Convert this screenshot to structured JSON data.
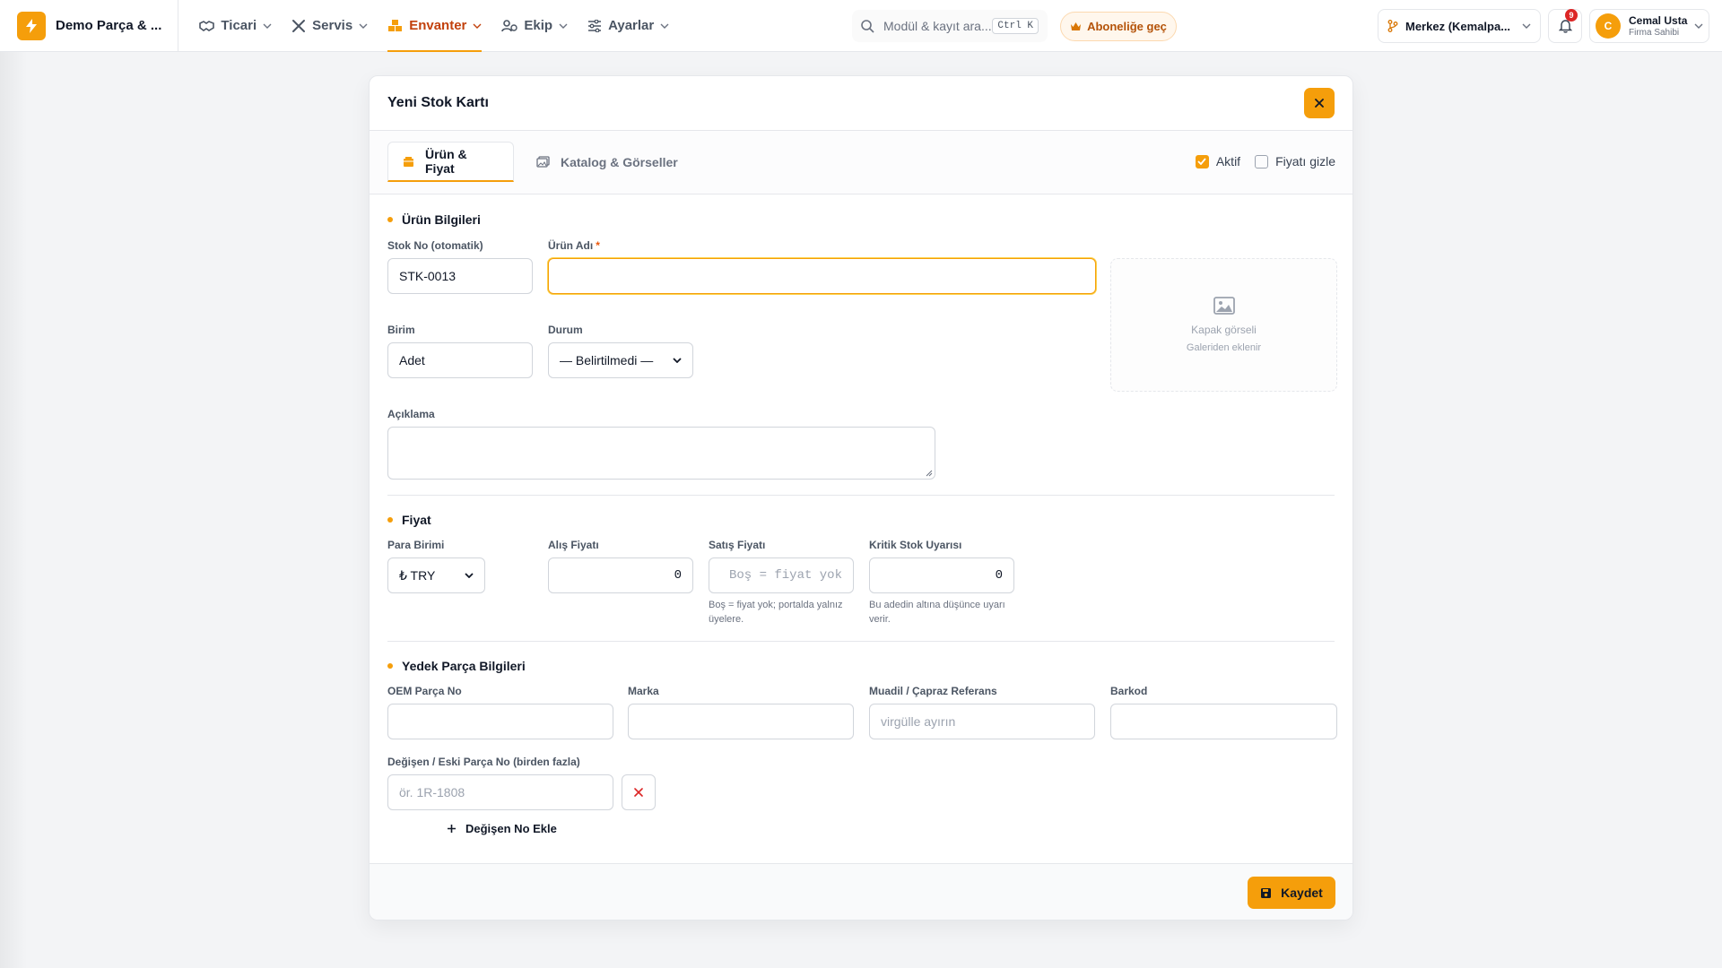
{
  "brand": {
    "name": "Demo Parça & ..."
  },
  "nav": {
    "items": [
      {
        "label": "Ticari",
        "icon": "handshake-icon"
      },
      {
        "label": "Servis",
        "icon": "tools-icon"
      },
      {
        "label": "Envanter",
        "icon": "boxes-icon",
        "active": true
      },
      {
        "label": "Ekip",
        "icon": "users-icon"
      },
      {
        "label": "Ayarlar",
        "icon": "sliders-icon"
      }
    ]
  },
  "search": {
    "placeholder": "Modül & kayıt ara...",
    "shortcut": "Ctrl K"
  },
  "subscribe": {
    "label": "Aboneliğe geç"
  },
  "branch": {
    "label": "Merkez (Kemalpa..."
  },
  "notifications": {
    "count": "9"
  },
  "user": {
    "initial": "C",
    "name": "Cemal Usta",
    "role": "Firma Sahibi"
  },
  "colors": {
    "accent": "#f59e0b",
    "accent_text": "#c2410c",
    "danger": "#dc2626"
  },
  "modal": {
    "title": "Yeni Stok Kartı",
    "tabs": [
      {
        "label": "Ürün & Fiyat",
        "icon": "box-icon"
      },
      {
        "label": "Katalog & Görseller",
        "icon": "images-icon"
      }
    ],
    "toggles": {
      "active_label": "Aktif",
      "active_checked": true,
      "hide_price_label": "Fiyatı gizle",
      "hide_price_checked": false
    },
    "product": {
      "section_title": "Ürün Bilgileri",
      "stock_no_label": "Stok No (otomatik)",
      "stock_no_value": "STK-0013",
      "name_label": "Ürün Adı",
      "required_mark": "*",
      "name_value": "",
      "unit_label": "Birim",
      "unit_value": "Adet",
      "status_label": "Durum",
      "status_value": "— Belirtilmedi —",
      "description_label": "Açıklama",
      "cover_title": "Kapak görseli",
      "cover_subtitle": "Galeriden eklenir"
    },
    "price": {
      "section_title": "Fiyat",
      "currency_label": "Para Birimi",
      "currency_value": "₺ TRY",
      "purchase_label": "Alış Fiyatı",
      "purchase_value": "0",
      "sale_label": "Satış Fiyatı",
      "sale_placeholder": "Boş = fiyat yok",
      "sale_hint": "Boş = fiyat yok; portalda yalnız üyelere.",
      "critical_label": "Kritik Stok Uyarısı",
      "critical_value": "0",
      "critical_hint": "Bu adedin altına düşünce uyarı verir."
    },
    "parts": {
      "section_title": "Yedek Parça Bilgileri",
      "oem_label": "OEM Parça No",
      "brand_label": "Marka",
      "cross_label": "Muadil / Çapraz Referans",
      "cross_placeholder": "virgülle ayırın",
      "barcode_label": "Barkod",
      "changed_label": "Değişen / Eski Parça No (birden fazla)",
      "changed_placeholder": "ör. 1R-1808",
      "add_label": "Değişen No Ekle"
    },
    "save_label": "Kaydet"
  }
}
